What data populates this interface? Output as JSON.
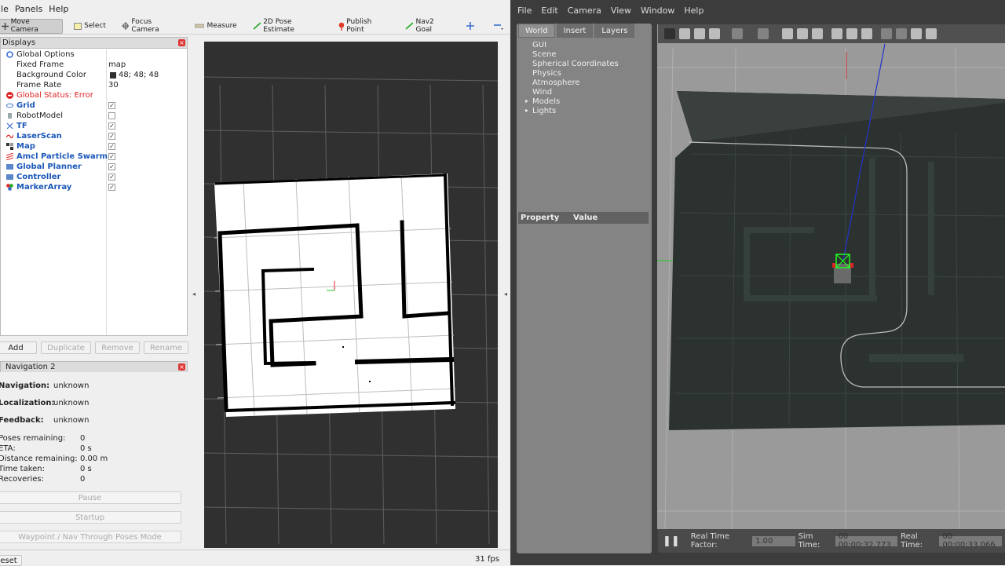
{
  "rviz": {
    "menu": [
      "ile",
      "Panels",
      "Help"
    ],
    "tools": [
      {
        "label": "Move Camera",
        "icon": "move-camera-icon",
        "active": true
      },
      {
        "label": "Select",
        "icon": "select-icon"
      },
      {
        "label": "Focus Camera",
        "icon": "focus-camera-icon"
      },
      {
        "label": "Measure",
        "icon": "measure-icon"
      },
      {
        "label": "2D Pose Estimate",
        "icon": "pose-estimate-icon"
      },
      {
        "label": "Publish Point",
        "icon": "publish-point-icon"
      },
      {
        "label": "Nav2 Goal",
        "icon": "nav2-goal-icon"
      }
    ],
    "displays": {
      "title": "Displays",
      "global_options": "Global Options",
      "fixed_frame_label": "Fixed Frame",
      "fixed_frame_value": "map",
      "bg_color_label": "Background Color",
      "bg_color_value": "48; 48; 48",
      "frame_rate_label": "Frame Rate",
      "frame_rate_value": "30",
      "global_status": "Global Status: Error",
      "items": [
        {
          "label": "Grid",
          "checked": true,
          "blue": true
        },
        {
          "label": "RobotModel",
          "checked": false,
          "blue": false
        },
        {
          "label": "TF",
          "checked": true,
          "blue": true
        },
        {
          "label": "LaserScan",
          "checked": true,
          "blue": true
        },
        {
          "label": "Map",
          "checked": true,
          "blue": true
        },
        {
          "label": "Amcl Particle Swarm",
          "checked": true,
          "blue": true
        },
        {
          "label": "Global Planner",
          "checked": true,
          "blue": true
        },
        {
          "label": "Controller",
          "checked": true,
          "blue": true
        },
        {
          "label": "MarkerArray",
          "checked": true,
          "blue": true
        }
      ],
      "buttons": [
        "Add",
        "Duplicate",
        "Remove",
        "Rename"
      ]
    },
    "nav": {
      "title": "Navigation 2",
      "navigation_label": "Navigation:",
      "navigation_value": "unknown",
      "localization_label": "Localization:",
      "localization_value": "unknown",
      "feedback_label": "Feedback:",
      "feedback_value": "unknown",
      "poses_label": "Poses remaining:",
      "poses_value": "0",
      "eta_label": "ETA:",
      "eta_value": "0 s",
      "distance_label": "Distance remaining:",
      "distance_value": "0.00 m",
      "time_label": "Time taken:",
      "time_value": "0 s",
      "recoveries_label": "Recoveries:",
      "recoveries_value": "0",
      "pause": "Pause",
      "startup": "Startup",
      "waypoint": "Waypoint / Nav Through Poses Mode"
    },
    "status": {
      "reset": "eset",
      "fps": "31 fps"
    }
  },
  "gazebo": {
    "menu": [
      "File",
      "Edit",
      "Camera",
      "View",
      "Window",
      "Help"
    ],
    "tabs": [
      "World",
      "Insert",
      "Layers"
    ],
    "tree": [
      "GUI",
      "Scene",
      "Spherical Coordinates",
      "Physics",
      "Atmosphere",
      "Wind",
      "Models",
      "Lights"
    ],
    "prop_header": [
      "Property",
      "Value"
    ],
    "rtf_label": "Real Time Factor:",
    "rtf_value": "1.00",
    "sim_label": "Sim Time:",
    "sim_value": "00 00:00:32.773",
    "real_label": "Real Time:",
    "real_value": "00 00:00:33.066"
  }
}
